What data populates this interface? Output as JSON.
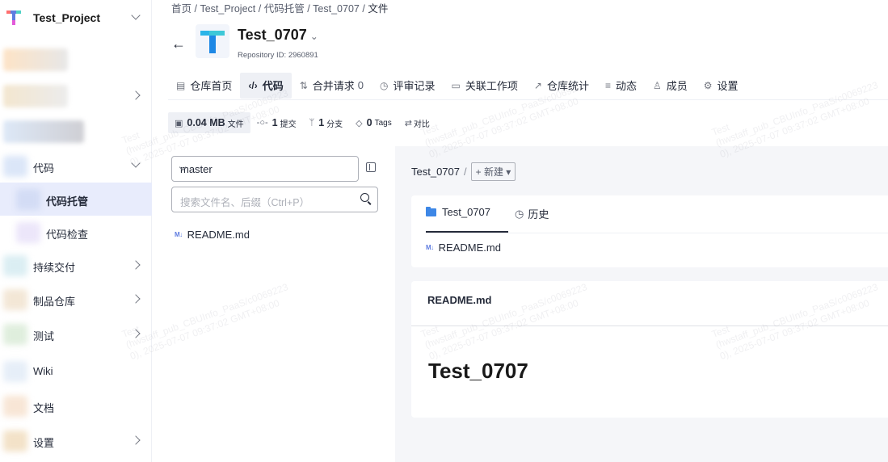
{
  "sidebar": {
    "project_name": "Test_Project",
    "items": [
      {
        "label": "代码",
        "expanded": true
      },
      {
        "label": "代码托管",
        "active": true
      },
      {
        "label": "代码检查"
      },
      {
        "label": "持续交付"
      },
      {
        "label": "制品仓库"
      },
      {
        "label": "测试"
      },
      {
        "label": "Wiki"
      },
      {
        "label": "文档"
      },
      {
        "label": "设置"
      }
    ]
  },
  "breadcrumb": {
    "items": [
      "首页",
      "Test_Project",
      "代码托管",
      "Test_0707"
    ],
    "current": "文件",
    "separator": "/"
  },
  "repo": {
    "name": "Test_0707",
    "id_label": "Repository ID: 2960891"
  },
  "tabs": [
    {
      "label": "仓库首页",
      "icon": "home-icon"
    },
    {
      "label": "代码",
      "icon": "code-icon",
      "active": true
    },
    {
      "label": "合并请求",
      "count": "0",
      "icon": "merge-request-icon"
    },
    {
      "label": "评审记录",
      "icon": "review-icon"
    },
    {
      "label": "关联工作项",
      "icon": "work-item-icon"
    },
    {
      "label": "仓库统计",
      "icon": "statistics-icon"
    },
    {
      "label": "动态",
      "icon": "activity-icon"
    },
    {
      "label": "成员",
      "icon": "member-icon"
    },
    {
      "label": "设置",
      "icon": "settings-icon"
    }
  ],
  "stats": {
    "size": "0.04 MB",
    "size_unit": "文件",
    "commits": "1",
    "commits_unit": "提交",
    "branches": "1",
    "branches_unit": "分支",
    "tags": "0",
    "tags_unit": "Tags",
    "compare": "对比"
  },
  "file_tree": {
    "branch": "master",
    "search_placeholder": "搜索文件名、后缀（Ctrl+P）",
    "files": [
      "README.md"
    ]
  },
  "content": {
    "path_root": "Test_0707",
    "path_sep": "/",
    "new_button": "+ 新建 ▾",
    "tab_folder": "Test_0707",
    "tab_history": "历史",
    "file": "README.md",
    "readme_title": "README.md",
    "readme_h1": "Test_0707"
  },
  "watermark": {
    "line1": "Test",
    "line2": "(hwstaff_pub_CBUInfo_PaaS/c0069223",
    "line3": "0), 2025-07-07 09:37:02 GMT+08:00"
  },
  "colors": {
    "accent": "#5e7ce0",
    "active_bg": "#e8ecfc",
    "page_bg": "#f5f6f9"
  }
}
